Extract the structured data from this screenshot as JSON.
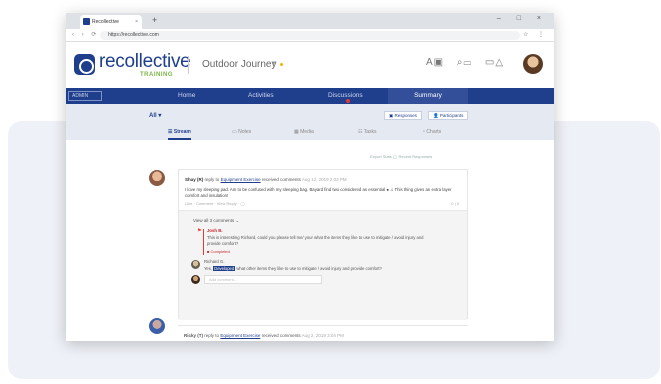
{
  "browser": {
    "tab_title": "Recollective",
    "new_tab": "+",
    "window_controls": "– □ ×",
    "nav_buttons": "‹ › ⟳",
    "url": "https://recollective.com"
  },
  "header": {
    "brand": "recollective",
    "brand_sub": "TRAINING",
    "journey": "Outdoor Journey",
    "journey_arrow": "▾"
  },
  "nav": {
    "admin": "ADMIN",
    "items": [
      "Home",
      "Activities",
      "Discussions",
      "Summary"
    ]
  },
  "filters": {
    "all": "All ▾",
    "responses": "Responses",
    "participants": "Participants",
    "tabs": [
      "Stream",
      "Notes",
      "Media",
      "Tasks",
      "Charts"
    ]
  },
  "content": {
    "sort_line": "Export Stats   ◯ Recent Responses",
    "post": {
      "author": "Shay (R)",
      "verb": "reply to",
      "activity": "Equipment Exercise",
      "verb2": "received comments",
      "date": "Aug 12, 2019 2:03 PM",
      "body": "I love my sleeping pad. Am to be confused with my sleeping bag. Bayard find two considered as essential ● ♫ This thing gives an extra layer comfort and insulation!",
      "meta": "Like · Comment · View Reply · ◯",
      "meta_right": "0 | 0"
    },
    "view_all": "View all 3 comments ⌄",
    "reply1": {
      "flag": "⚑",
      "name": "Josh B.",
      "text": "This is interesting Richard, could you please tell me/ your what the items they like to use to mitigate / avoid injury and provide comfort?",
      "status": "Completed"
    },
    "reply2": {
      "name": "Richard G.",
      "prefix": "Yes,",
      "highlight": "Developed",
      "text": "what other items they like to use to mitigate / avoid injury and provide comfort?"
    },
    "compose_placeholder": "Add comment...",
    "post2": {
      "author": "Ricky (T)",
      "verb": "reply to",
      "activity": "Equipment Exercise",
      "verb2": "received comments",
      "date": "Aug 2, 2019 3:04 PM"
    }
  }
}
